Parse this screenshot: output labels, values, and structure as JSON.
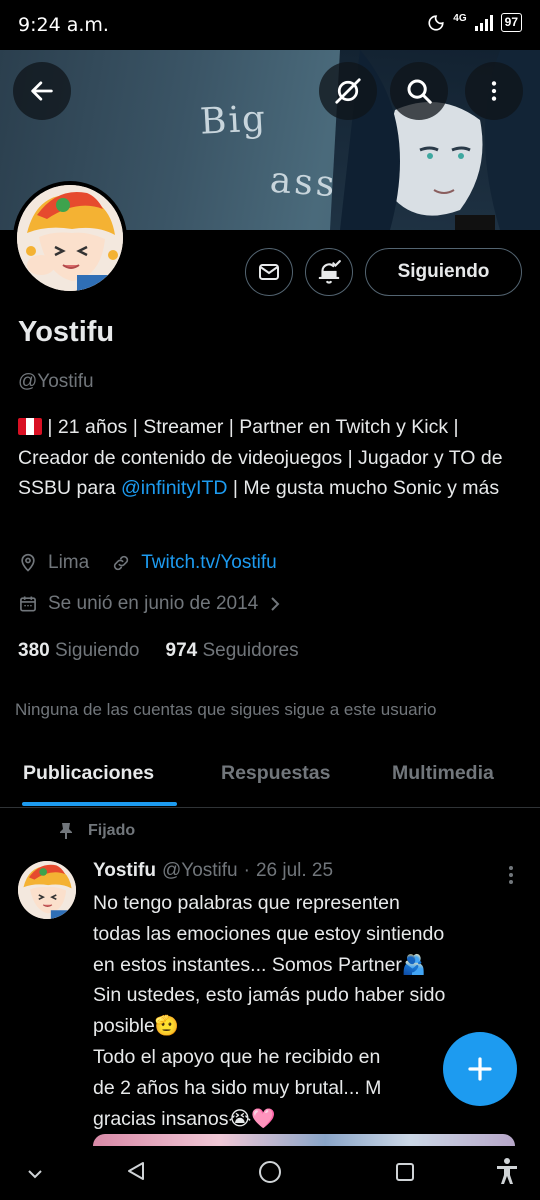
{
  "status_bar": {
    "time": "9:24 a.m.",
    "network": "4G",
    "battery": "97"
  },
  "banner": {
    "art_text_line1": "Big",
    "art_text_line2": "ass"
  },
  "profile": {
    "name": "Yostifu",
    "handle": "@Yostifu",
    "follow_label": "Siguiendo",
    "bio_part1": " | 21 años | Streamer | Partner en Twitch y Kick | Creador de contenido de videojuegos | Jugador y TO de SSBU para ",
    "bio_mention": "@infinityITD",
    "bio_part2": " | Me gusta mucho Sonic y más",
    "location": "Lima",
    "website": "Twitch.tv/Yostifu",
    "joined": "Se unió en junio de 2014",
    "following_count": "380",
    "following_label": "Siguiendo",
    "followers_count": "974",
    "followers_label": "Seguidores",
    "mutuals_notice": "Ninguna de las cuentas que sigues sigue a este usuario"
  },
  "tabs": [
    {
      "label": "Publicaciones",
      "active": true
    },
    {
      "label": "Respuestas",
      "active": false
    },
    {
      "label": "Multimedia",
      "active": false
    }
  ],
  "post": {
    "pinned_label": "Fijado",
    "author_name": "Yostifu",
    "author_handle": "@Yostifu",
    "separator": "·",
    "date": "26 jul. 25",
    "lines": [
      "No tengo palabras que representen",
      "todas las emociones que estoy sintiendo",
      "en estos instantes... Somos Partner🫂",
      "Sin ustedes, esto jamás pudo haber sido",
      "posible🫡",
      "Todo el apoyo que he recibido en",
      "de 2 años ha sido muy brutal... M",
      "gracias insanos😭🩷"
    ]
  },
  "colors": {
    "accent": "#1d9bf0",
    "muted": "#71767b",
    "text": "#e7e9ea",
    "border": "#536471"
  },
  "icons": [
    "back-arrow-icon",
    "mute-icon",
    "search-icon",
    "more-vertical-icon",
    "message-icon",
    "bell-icon",
    "location-icon",
    "link-icon",
    "calendar-icon",
    "chevron-right-icon",
    "pin-icon",
    "plus-icon",
    "nav-back-icon",
    "nav-home-icon",
    "nav-recents-icon",
    "nav-chevron-icon",
    "accessibility-icon"
  ]
}
